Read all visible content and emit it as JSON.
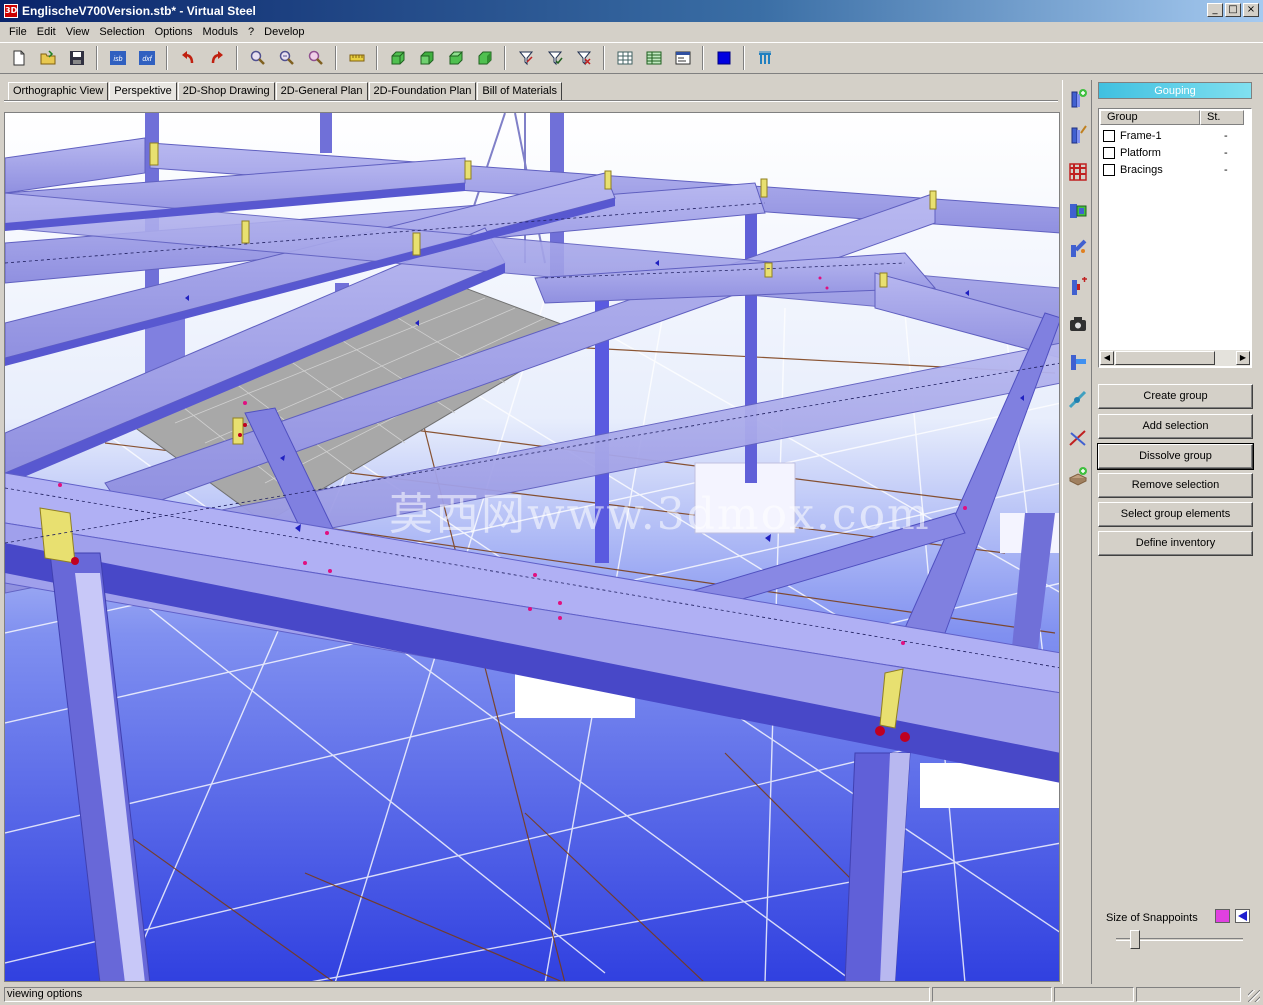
{
  "window": {
    "title": "EnglischeV700Version.stb* - Virtual Steel",
    "app_icon": "3D"
  },
  "menu": [
    "File",
    "Edit",
    "View",
    "Selection",
    "Options",
    "Moduls",
    "?",
    "Develop"
  ],
  "toolbar": {
    "icons": [
      "new-file-icon",
      "open-folder-icon",
      "save-icon",
      "isb-export-icon",
      "dxf-export-icon",
      "undo-icon",
      "redo-icon",
      "zoom-in-icon",
      "zoom-out-icon",
      "zoom-fit-icon",
      "measure-ruler-icon",
      "view-front-icon",
      "view-side-icon",
      "view-top-icon",
      "view-iso-icon",
      "filter-icon",
      "filter-select-icon",
      "filter-clear-icon",
      "table-icon",
      "grid-icon",
      "properties-icon",
      "color-icon",
      "structure-icon"
    ],
    "isb_label": "isb",
    "dxf_label": "dxf"
  },
  "tabs": [
    "Orthographic View",
    "Perspektive",
    "2D-Shop Drawing",
    "2D-General Plan",
    "2D-Foundation Plan",
    "Bill of Materials"
  ],
  "active_tab": "Perspektive",
  "watermark": "莫西网www.3dmox.com",
  "side_tools": [
    "add-column-icon",
    "edit-column-icon",
    "grid-icon",
    "connection-icon",
    "beam-link-icon",
    "add-part-icon",
    "camera-icon",
    "plate-icon",
    "weld-icon",
    "cut-icon",
    "add-material-icon"
  ],
  "grouping": {
    "header": "Gouping",
    "columns": {
      "group": "Group",
      "status": "St."
    },
    "groups": [
      {
        "name": "Frame-1",
        "status": "-"
      },
      {
        "name": "Platform",
        "status": "-"
      },
      {
        "name": "Bracings",
        "status": "-"
      }
    ],
    "buttons": {
      "create": "Create group",
      "add": "Add selection",
      "dissolve": "Dissolve group",
      "remove": "Remove selection",
      "select": "Select group elements",
      "inventory": "Define inventory"
    },
    "snap_label": "Size of Snappoints",
    "snap_size_fraction": 0.12
  },
  "status": {
    "text": "viewing options"
  },
  "colors": {
    "steel": "#9a9ae8",
    "floor": "#4a5ae0",
    "title": "#0a246a",
    "panel_header": "#40c0e0"
  }
}
